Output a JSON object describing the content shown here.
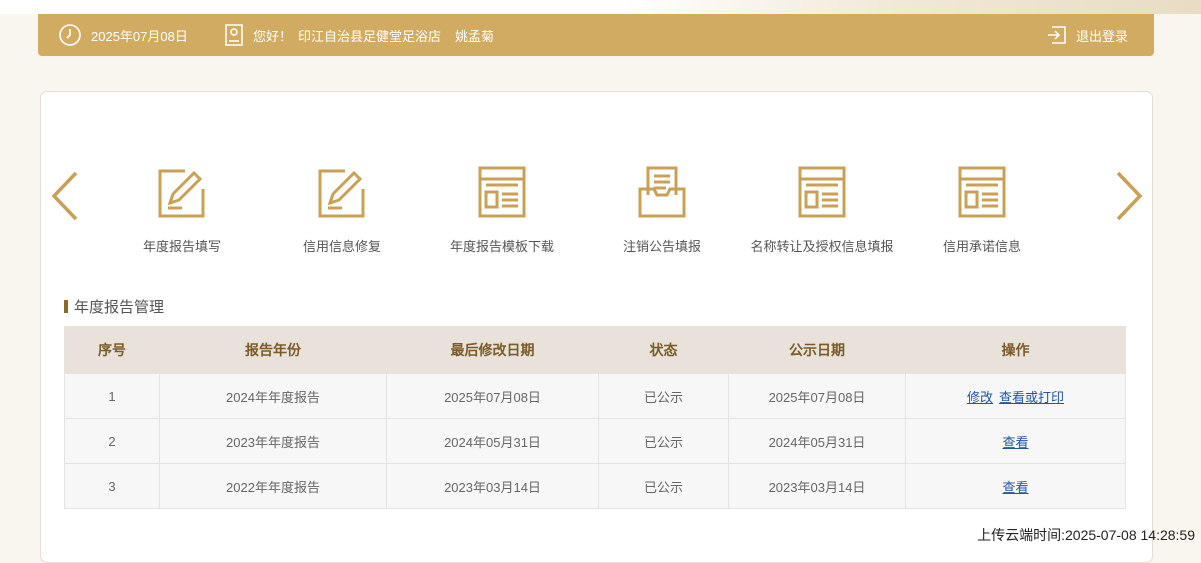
{
  "header": {
    "date": "2025年07月08日",
    "greeting": "您好！",
    "store": "印江自治县足健堂足浴店",
    "user": "姚孟菊",
    "logout": "退出登录"
  },
  "functions": [
    {
      "label": "年度报告填写",
      "icon": "edit-icon"
    },
    {
      "label": "信用信息修复",
      "icon": "edit-icon"
    },
    {
      "label": "年度报告模板下载",
      "icon": "document-icon"
    },
    {
      "label": "注销公告填报",
      "icon": "inbox-icon"
    },
    {
      "label": "名称转让及授权信息填报",
      "icon": "document-icon"
    },
    {
      "label": "信用承诺信息",
      "icon": "document-icon"
    }
  ],
  "section": {
    "title": "年度报告管理"
  },
  "table": {
    "headers": [
      "序号",
      "报告年份",
      "最后修改日期",
      "状态",
      "公示日期",
      "操作"
    ],
    "rows": [
      {
        "no": "1",
        "year": "2024年年度报告",
        "modified": "2025年07月08日",
        "status": "已公示",
        "published": "2025年07月08日",
        "actions": [
          "修改",
          "查看或打印"
        ]
      },
      {
        "no": "2",
        "year": "2023年年度报告",
        "modified": "2024年05月31日",
        "status": "已公示",
        "published": "2024年05月31日",
        "actions": [
          "查看"
        ]
      },
      {
        "no": "3",
        "year": "2022年年度报告",
        "modified": "2023年03月14日",
        "status": "已公示",
        "published": "2023年03月14日",
        "actions": [
          "查看"
        ]
      }
    ]
  },
  "footer": {
    "upload_time": "上传云端时间:2025-07-08 14:28:59"
  },
  "colors": {
    "accent": "#d1ab62",
    "icon": "#c9a055",
    "link": "#2255a4"
  }
}
